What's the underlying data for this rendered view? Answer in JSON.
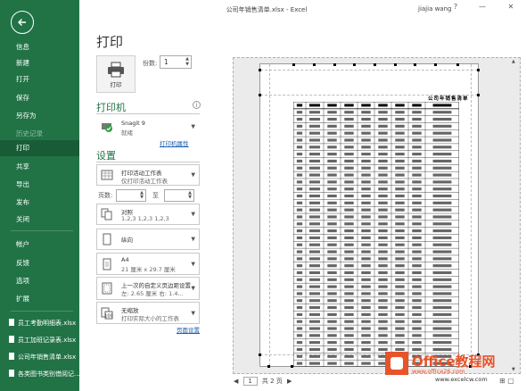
{
  "window": {
    "title": "公司年销售清单.xlsx - Excel",
    "user": "jiajia wang",
    "help": "?",
    "minimize": "—",
    "close": "✕"
  },
  "nav": {
    "items": [
      {
        "label": "信息",
        "state": "normal"
      },
      {
        "label": "新建",
        "state": "normal"
      },
      {
        "label": "打开",
        "state": "normal"
      },
      {
        "label": "保存",
        "state": "normal"
      },
      {
        "label": "另存为",
        "state": "normal"
      },
      {
        "label": "历史记录",
        "state": "dim"
      },
      {
        "label": "打印",
        "state": "active"
      },
      {
        "label": "共享",
        "state": "normal"
      },
      {
        "label": "导出",
        "state": "normal"
      },
      {
        "label": "发布",
        "state": "normal"
      },
      {
        "label": "关闭",
        "state": "normal"
      },
      {
        "label": "帐户",
        "state": "normal"
      },
      {
        "label": "反馈",
        "state": "normal"
      },
      {
        "label": "选项",
        "state": "normal"
      },
      {
        "label": "扩展",
        "state": "normal"
      }
    ],
    "recent": [
      "员工考勤明细表.xlsx",
      "员工加班记录表.xlsx",
      "公司年销售清单.xlsx",
      "各类图书类别借阅记..."
    ]
  },
  "print": {
    "title": "打印",
    "button_label": "打印",
    "copies_label": "份数:",
    "copies_value": "1"
  },
  "printer": {
    "header": "打印机",
    "name": "Snagit 9",
    "status": "就绪",
    "properties_link": "打印机属性"
  },
  "settings": {
    "header": "设置",
    "scope_line1": "打印活动工作表",
    "scope_line2": "仅打印活动工作表",
    "pages_label": "页数:",
    "to_label": "至",
    "collate_line1": "对照",
    "collate_line2": "1,2,3    1,2,3    1,2,3",
    "orientation": "纵向",
    "paper_line1": "A4",
    "paper_line2": "21 厘米 x 29.7 厘米",
    "margins_line1": "上一次的自定义页边距设置",
    "margins_line2": "左: 2.65 厘米    右: 1.4...",
    "scaling_line1": "无缩放",
    "scaling_line2": "打印实际大小的工作表",
    "page_setup_link": "页面设置"
  },
  "preview": {
    "sheet_title": "公司年销售清单",
    "page_current": "1",
    "page_total_label": "共 2 页"
  },
  "watermark": {
    "brand": "Office教程网",
    "url1": "www.office26.com",
    "url2": "www.excelcw.com"
  }
}
